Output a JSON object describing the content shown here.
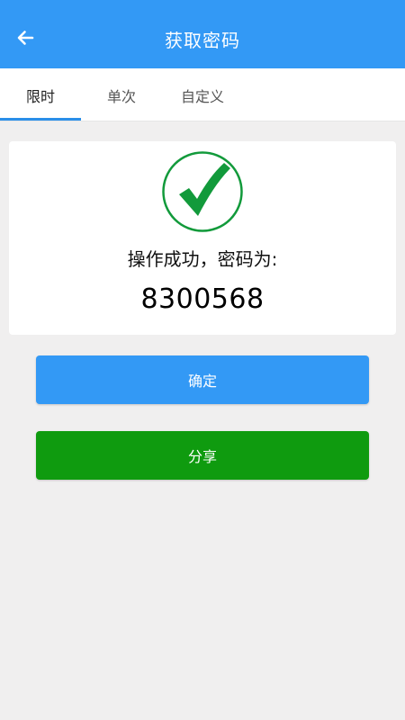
{
  "header": {
    "title": "获取密码",
    "back_icon": "arrow-left-icon"
  },
  "tabs": [
    {
      "label": "限时",
      "active": true
    },
    {
      "label": "单次",
      "active": false
    },
    {
      "label": "自定义",
      "active": false
    }
  ],
  "result": {
    "icon": "check-circle-icon",
    "message": "操作成功，密码为:",
    "password": "8300568"
  },
  "actions": {
    "confirm_label": "确定",
    "share_label": "分享"
  },
  "colors": {
    "primary": "#3399f5",
    "success": "#0f9b0f",
    "check_green": "#129a3b",
    "background": "#f0efef"
  }
}
